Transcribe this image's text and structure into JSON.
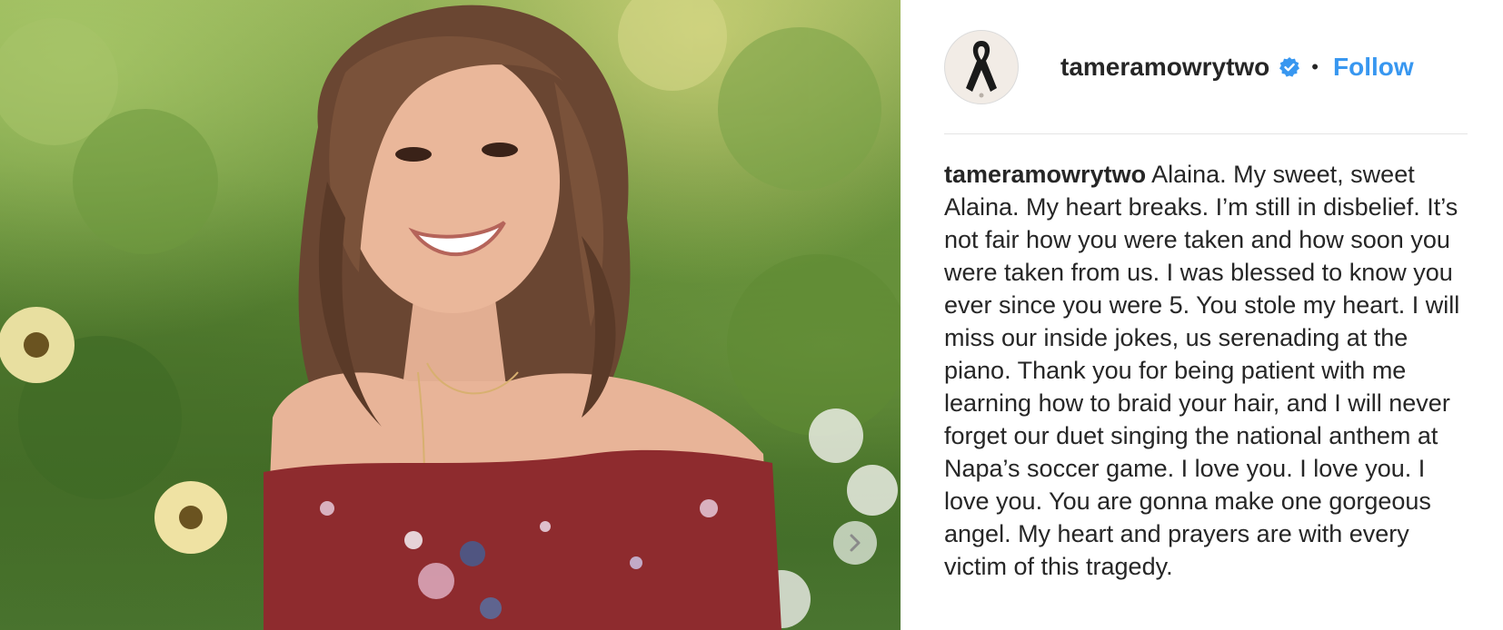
{
  "post": {
    "photo": {
      "alt_icon": "portrait-photo"
    },
    "carousel": {
      "next_icon": "chevron-right-icon"
    },
    "header": {
      "username": "tameramowrytwo",
      "verified_icon": "verified-badge-icon",
      "separator": "•",
      "follow_label": "Follow",
      "avatar_icon": "awareness-ribbon-icon"
    },
    "caption": {
      "username": "tameramowrytwo",
      "text": "Alaina. My sweet, sweet Alaina. My heart breaks. I’m still in disbelief. It’s not fair how you were taken and how soon you were taken from us. I was blessed to know you ever since you were 5. You stole my heart. I will miss our inside jokes, us serenading at the piano. Thank you for being patient with me learning how to braid your hair, and I will never forget our duet singing the national anthem at Napa’s soccer game. I love you. I love you. I love you. You are gonna make one gorgeous angel. My heart and prayers are with every victim of this tragedy."
    },
    "colors": {
      "follow": "#3897f0",
      "verified": "#3897f0",
      "text": "#262626",
      "divider": "#e4e4e4"
    }
  }
}
